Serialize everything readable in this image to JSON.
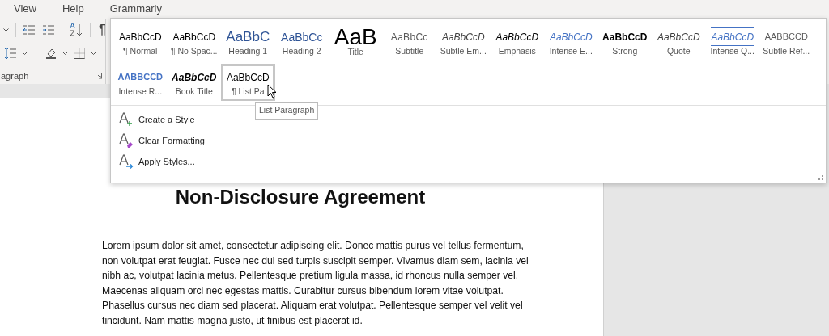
{
  "ribbon": {
    "tabs": [
      {
        "label": "View"
      },
      {
        "label": "Help"
      },
      {
        "label": "Grammarly"
      }
    ],
    "pilcrow": "¶",
    "group_label": "agraph"
  },
  "style_gallery": {
    "rows": [
      [
        {
          "kind": "normal",
          "preview": "AaBbCcD",
          "label": "¶ Normal",
          "selected": false
        },
        {
          "kind": "no-spacing",
          "preview": "AaBbCcD",
          "label": "¶ No Spac...",
          "selected": false
        },
        {
          "kind": "heading1",
          "preview": "AaBbC",
          "label": "Heading 1",
          "selected": false
        },
        {
          "kind": "heading2",
          "preview": "AaBbCc",
          "label": "Heading 2",
          "selected": false
        },
        {
          "kind": "title",
          "preview": "AaB",
          "label": "Title",
          "selected": false
        },
        {
          "kind": "subtitle",
          "preview": "AaBbCc",
          "label": "Subtitle",
          "selected": false
        },
        {
          "kind": "subtle-emphasis",
          "preview": "AaBbCcD",
          "label": "Subtle Em...",
          "selected": false
        },
        {
          "kind": "emphasis",
          "preview": "AaBbCcD",
          "label": "Emphasis",
          "selected": false
        },
        {
          "kind": "intense-emphasis",
          "preview": "AaBbCcD",
          "label": "Intense E...",
          "selected": false
        },
        {
          "kind": "strong",
          "preview": "AaBbCcD",
          "label": "Strong",
          "selected": false
        },
        {
          "kind": "quote",
          "preview": "AaBbCcD",
          "label": "Quote",
          "selected": false
        },
        {
          "kind": "intense-quote",
          "preview": "AaBbCcD",
          "label": "Intense Q...",
          "selected": false
        },
        {
          "kind": "subtle-reference",
          "preview": "AABBCCD",
          "label": "Subtle Ref...",
          "selected": false
        }
      ],
      [
        {
          "kind": "intense-reference",
          "preview": "AABBCCD",
          "label": "Intense R...",
          "selected": false
        },
        {
          "kind": "book-title",
          "preview": "AaBbCcD",
          "label": "Book Title",
          "selected": false
        },
        {
          "kind": "normal",
          "preview": "AaBbCcD",
          "label": "¶ List Pa",
          "selected": true
        }
      ]
    ],
    "tooltip": "List Paragraph",
    "menu": [
      {
        "kind": "create",
        "label": "Create a Style"
      },
      {
        "kind": "clear",
        "label": "Clear Formatting"
      },
      {
        "kind": "apply",
        "label": "Apply Styles..."
      }
    ]
  },
  "document": {
    "heading": "Non-Disclosure Agreement",
    "paragraph": "Lorem ipsum dolor sit amet, consectetur adipiscing elit. Donec mattis purus vel tellus fermentum, non volutpat erat feugiat. Fusce nec dui sed turpis suscipit semper. Vivamus diam sem, lacinia vel nibh ac, volutpat lacinia metus. Pellentesque pretium ligula massa, id rhoncus nulla semper vel. Maecenas aliquam orci nec egestas mattis. Curabitur cursus bibendum lorem vitae volutpat. Phasellus cursus nec diam sed placerat. Aliquam erat volutpat. Pellentesque semper vel velit vel tincidunt. Nam mattis magna justo, ut finibus est placerat id."
  }
}
